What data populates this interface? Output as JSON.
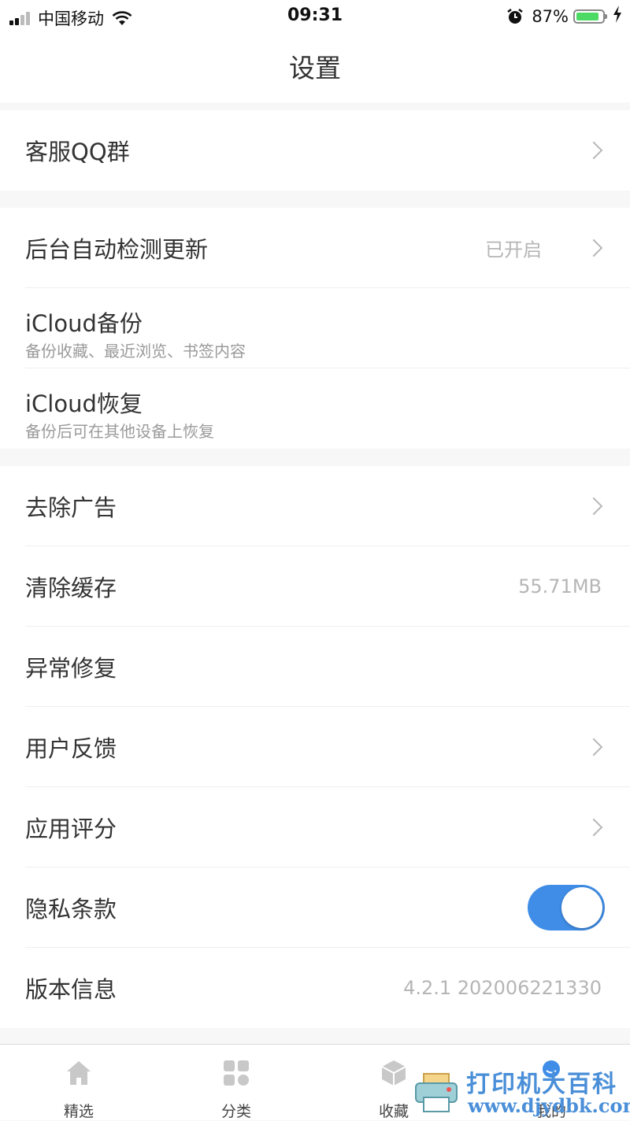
{
  "status_bar": {
    "carrier": "中国移动",
    "time": "09:31",
    "battery_percent": "87%",
    "battery_level": 0.87,
    "icons": [
      "signal-icon",
      "wifi-icon",
      "alarm-icon",
      "battery-icon",
      "charging-bolt-icon"
    ]
  },
  "nav": {
    "title": "设置"
  },
  "groups": [
    {
      "items": [
        {
          "label": "客服QQ群",
          "chevron": true
        }
      ]
    },
    {
      "items": [
        {
          "label": "后台自动检测更新",
          "value": "已开启",
          "chevron": true
        },
        {
          "label": "iCloud备份",
          "subtitle": "备份收藏、最近浏览、书签内容"
        },
        {
          "label": "iCloud恢复",
          "subtitle": "备份后可在其他设备上恢复"
        }
      ]
    },
    {
      "items": [
        {
          "label": "去除广告",
          "chevron": true
        },
        {
          "label": "清除缓存",
          "value": "55.71MB"
        },
        {
          "label": "异常修复"
        },
        {
          "label": "用户反馈",
          "chevron": true
        },
        {
          "label": "应用评分",
          "chevron": true
        },
        {
          "label": "隐私条款",
          "toggle_on": true
        },
        {
          "label": "版本信息",
          "value": "4.2.1 202006221330"
        }
      ]
    }
  ],
  "tabbar": {
    "tabs": [
      {
        "label": "精选",
        "icon": "home-icon"
      },
      {
        "label": "分类",
        "icon": "grid-icon"
      },
      {
        "label": "收藏",
        "icon": "cube-icon"
      },
      {
        "label": "我的",
        "icon": "person-icon"
      }
    ]
  },
  "watermark": {
    "line1": "打印机大百科",
    "line2": "www.djydbk.com"
  },
  "colors": {
    "accent": "#3f8de6",
    "battery": "#4cd964",
    "background": "#f7f7f7"
  }
}
